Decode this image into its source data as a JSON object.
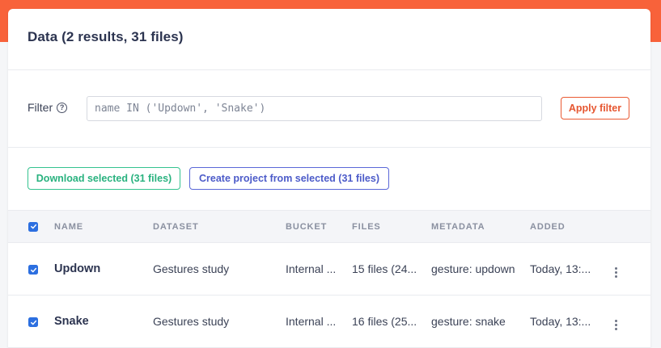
{
  "header": {
    "title": "Data (2 results, 31 files)"
  },
  "filter": {
    "label": "Filter",
    "help_icon": "question-circle-icon",
    "placeholder": "name IN ('Updown', 'Snake')",
    "apply_label": "Apply filter"
  },
  "actions": {
    "download_label": "Download selected (31 files)",
    "create_project_label": "Create project from selected (31 files)"
  },
  "table": {
    "select_all_checked": true,
    "columns": [
      "NAME",
      "DATASET",
      "BUCKET",
      "FILES",
      "METADATA",
      "ADDED"
    ],
    "rows": [
      {
        "checked": true,
        "name": "Updown",
        "dataset": "Gestures study",
        "bucket": "Internal ...",
        "files": "15 files (24...",
        "metadata": "gesture: updown",
        "added": "Today, 13:..."
      },
      {
        "checked": true,
        "name": "Snake",
        "dataset": "Gestures study",
        "bucket": "Internal ...",
        "files": "16 files (25...",
        "metadata": "gesture: snake",
        "added": "Today, 13:..."
      }
    ]
  },
  "colors": {
    "brand_orange": "#f8623a",
    "apply_orange": "#e65630",
    "download_green": "#29b27f",
    "project_blue": "#4c5bc9",
    "checkbox_blue": "#2c6fe0"
  }
}
